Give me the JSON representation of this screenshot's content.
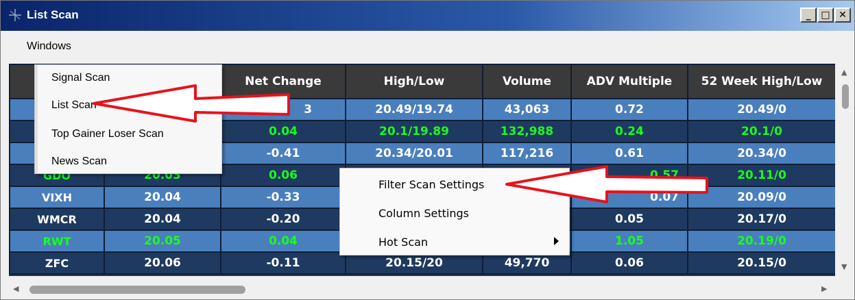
{
  "window": {
    "title": "List Scan",
    "btn_minimize": "_",
    "btn_maximize": "□",
    "btn_close": "✕"
  },
  "menubar": {
    "windows": "Windows"
  },
  "dropdown": {
    "items": [
      "Signal Scan",
      "List Scan",
      "Top Gainer Loser Scan",
      "News Scan"
    ]
  },
  "context_menu": {
    "items": [
      "Filter Scan Settings",
      "Column Settings",
      "Hot Scan"
    ]
  },
  "table": {
    "headers": [
      "",
      "",
      "Net Change",
      "High/Low",
      "Volume",
      "ADV Multiple",
      "52 Week High/Low"
    ],
    "rows": [
      [
        "",
        "",
        "3",
        "20.49/19.74",
        "43,063",
        "0.72",
        "20.49/0"
      ],
      [
        "",
        "",
        "0.04",
        "20.1/19.89",
        "132,988",
        "0.24",
        "20.1/0"
      ],
      [
        "",
        "",
        "-0.41",
        "20.34/20.01",
        "117,216",
        "0.61",
        "20.34/0"
      ],
      [
        "GDO",
        "20.03",
        "0.06",
        "",
        "",
        "0.57",
        "20.11/0"
      ],
      [
        "VIXH",
        "20.04",
        "-0.33",
        "",
        "",
        "0.07",
        "20.09/0"
      ],
      [
        "WMCR",
        "20.04",
        "-0.20",
        "",
        "",
        "0.05",
        "20.17/0"
      ],
      [
        "RWT",
        "20.05",
        "0.04",
        "",
        "",
        "1.05",
        "20.19/0"
      ],
      [
        "ZFC",
        "20.06",
        "-0.11",
        "20.15/20",
        "49,770",
        "0.06",
        "20.15/0"
      ]
    ]
  },
  "colors": {
    "title_gradient_start": "#0a246a",
    "header_bg": "#3a3a3a",
    "row_light": "#4a7fbd",
    "row_dark": "#1f3a61",
    "up_green": "#1aff1a",
    "annotation_red": "#e8121b"
  },
  "icons": {
    "window_icon": "scan-window-icon",
    "submenu_arrow": "chevron-right-icon"
  }
}
